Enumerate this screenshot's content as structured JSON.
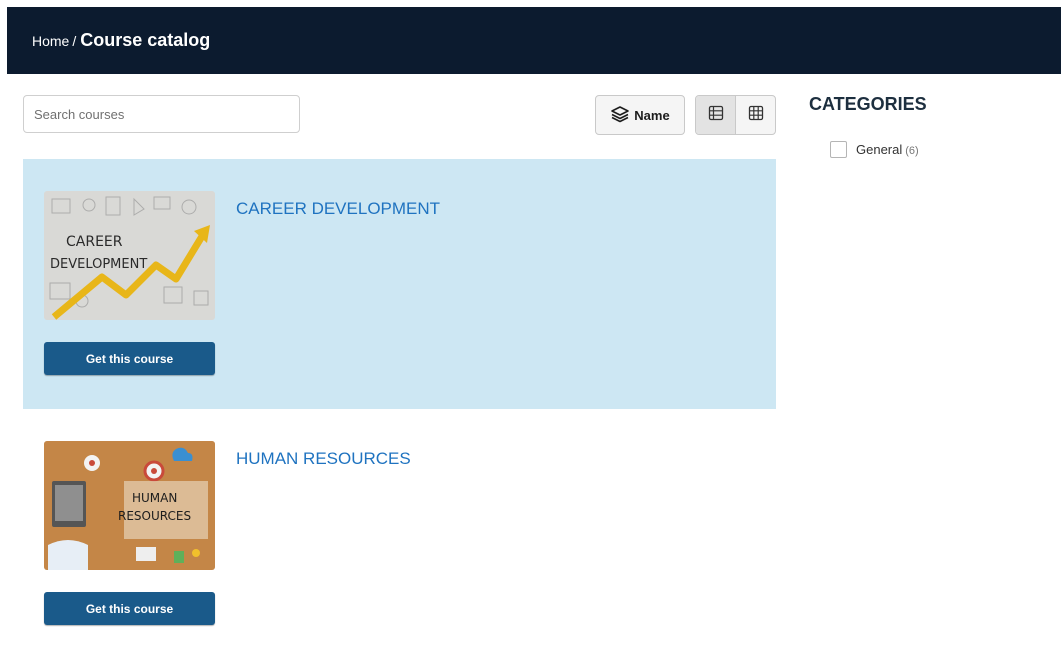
{
  "breadcrumb": {
    "home": "Home",
    "separator": "/",
    "current": "Course catalog"
  },
  "search": {
    "placeholder": "Search courses",
    "value": ""
  },
  "toolbar": {
    "sort_label": "Name",
    "sort_icon": "layers-icon",
    "view_list_icon": "list-view-icon",
    "view_grid_icon": "grid-view-icon",
    "active_view": "list"
  },
  "courses": [
    {
      "title": "CAREER DEVELOPMENT",
      "thumbnail_text": [
        "CAREER",
        "DEVELOPMENT"
      ],
      "button": "Get this course",
      "highlighted": true
    },
    {
      "title": "HUMAN RESOURCES",
      "thumbnail_text": [
        "HUMAN",
        "RESOURCES"
      ],
      "button": "Get this course",
      "highlighted": false
    }
  ],
  "sidebar": {
    "heading": "CATEGORIES",
    "categories": [
      {
        "label": "General",
        "count": "(6)",
        "checked": false
      }
    ]
  },
  "colors": {
    "header_bg": "#0c1b2f",
    "highlight_bg": "#cde7f3",
    "link": "#1f73c0",
    "button_bg": "#1a5a8a"
  }
}
